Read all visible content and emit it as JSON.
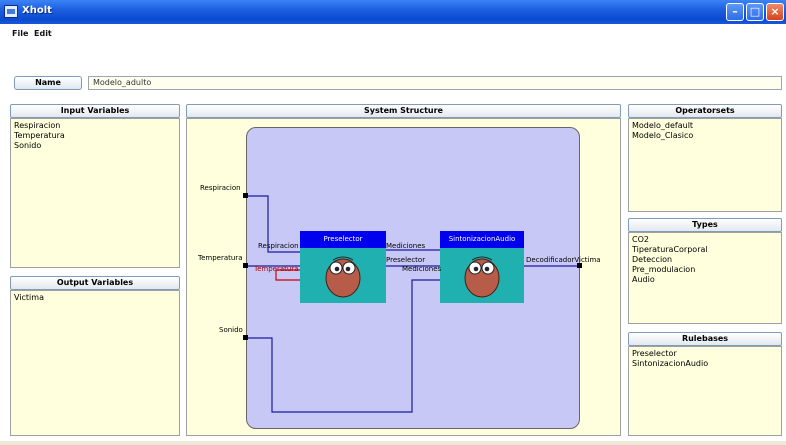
{
  "window": {
    "title": "Xholt"
  },
  "menu": {
    "file": "File",
    "edit": "Edit"
  },
  "name_row": {
    "button_label": "Name",
    "value": "Modelo_adulto"
  },
  "input_variables": {
    "header": "Input Variables",
    "items": [
      "Respiracion",
      "Temperatura",
      "Sonido"
    ]
  },
  "output_variables": {
    "header": "Output Variables",
    "items": [
      "Victima"
    ]
  },
  "system_structure": {
    "header": "System Structure",
    "inputs": [
      "Respiracion",
      "Temperatura",
      "Sonido"
    ],
    "blocks": [
      {
        "title": "Preselector",
        "in_ports": [
          "Respiracion",
          "Temperatura"
        ],
        "out_ports": [
          "Mediciones",
          "Preselector"
        ]
      },
      {
        "title": "SintonizacionAudio",
        "in_ports": [
          "Mediciones",
          "Preselector",
          "Mediciones"
        ],
        "out_ports": [
          "DecodificadorVictima"
        ]
      }
    ]
  },
  "operatorsets": {
    "header": "Operatorsets",
    "items": [
      "Modelo_default",
      "Modelo_Clasico"
    ]
  },
  "types": {
    "header": "Types",
    "items": [
      "CO2",
      "TiperaturaCorporal",
      "Deteccion",
      "Pre_modulacion",
      "Audio"
    ]
  },
  "rulebases": {
    "header": "Rulebases",
    "items": [
      "Preselector",
      "SintonizacionAudio"
    ]
  },
  "icons": {
    "app": "app-window-icon",
    "minimize": "minimize-icon",
    "maximize": "maximize-icon",
    "close": "close-icon",
    "block": "brain-mascot-icon"
  },
  "colors": {
    "block_title": "#0000ee",
    "block_body": "#20b0b0",
    "subsystem": "#c8c8f6",
    "panel_bg": "#ffffdd",
    "wire": "#1a1aa0"
  }
}
